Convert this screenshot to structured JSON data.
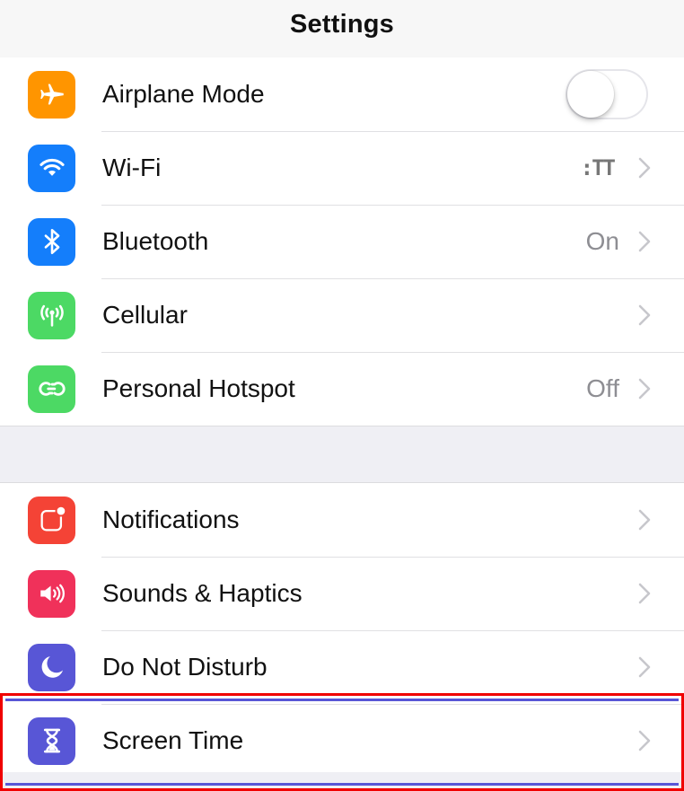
{
  "header": {
    "title": "Settings"
  },
  "group1": [
    {
      "id": "airplane",
      "label": "Airplane Mode",
      "icon": "airplane-icon",
      "icon_color": "#ff9500",
      "control": "toggle",
      "toggle_on": false
    },
    {
      "id": "wifi",
      "label": "Wi-Fi",
      "icon": "wifi-icon",
      "icon_color": "#147efb",
      "value": ":TT",
      "control": "chevron"
    },
    {
      "id": "bluetooth",
      "label": "Bluetooth",
      "icon": "bluetooth-icon",
      "icon_color": "#147efb",
      "value": "On",
      "control": "chevron"
    },
    {
      "id": "cellular",
      "label": "Cellular",
      "icon": "antenna-icon",
      "icon_color": "#4cd964",
      "control": "chevron"
    },
    {
      "id": "hotspot",
      "label": "Personal Hotspot",
      "icon": "hotspot-link-icon",
      "icon_color": "#4cd964",
      "value": "Off",
      "control": "chevron"
    }
  ],
  "group2": [
    {
      "id": "notifications",
      "label": "Notifications",
      "icon": "notifications-icon",
      "icon_color": "#f44336",
      "control": "chevron"
    },
    {
      "id": "sounds",
      "label": "Sounds & Haptics",
      "icon": "speaker-icon",
      "icon_color": "#f0315a",
      "control": "chevron"
    },
    {
      "id": "dnd",
      "label": "Do Not Disturb",
      "icon": "moon-icon",
      "icon_color": "#5856d6",
      "control": "chevron"
    },
    {
      "id": "screentime",
      "label": "Screen Time",
      "icon": "hourglass-icon",
      "icon_color": "#5856d6",
      "control": "chevron",
      "highlighted": true
    }
  ],
  "annotation": {
    "highlight_color": "#f00000",
    "target": "Screen Time"
  }
}
